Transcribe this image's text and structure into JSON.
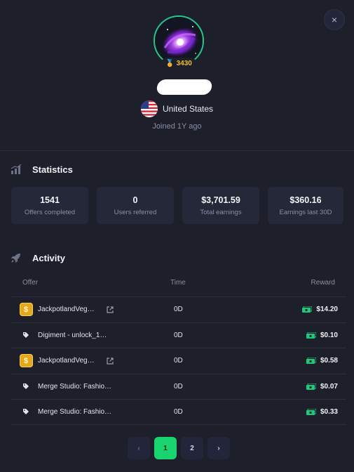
{
  "close_label": "×",
  "profile": {
    "level": "3430",
    "country": "United States",
    "joined": "Joined 1Y ago"
  },
  "statistics": {
    "title": "Statistics",
    "cards": [
      {
        "value": "1541",
        "label": "Offers completed"
      },
      {
        "value": "0",
        "label": "Users referred"
      },
      {
        "value": "$3,701.59",
        "label": "Total earnings"
      },
      {
        "value": "$360.16",
        "label": "Earnings last 30D"
      }
    ]
  },
  "activity": {
    "title": "Activity",
    "columns": {
      "offer": "Offer",
      "time": "Time",
      "reward": "Reward"
    },
    "rows": [
      {
        "offer": "JackpotlandVeg…",
        "time": "0D",
        "reward": "$14.20",
        "icon": "coin-icon",
        "external": true
      },
      {
        "offer": "Digiment - unlock_1…",
        "time": "0D",
        "reward": "$0.10",
        "icon": "tag-icon",
        "external": false
      },
      {
        "offer": "JackpotlandVeg…",
        "time": "0D",
        "reward": "$0.58",
        "icon": "coin-icon",
        "external": true
      },
      {
        "offer": "Merge Studio: Fashio…",
        "time": "0D",
        "reward": "$0.07",
        "icon": "tag-icon",
        "external": false
      },
      {
        "offer": "Merge Studio: Fashio…",
        "time": "0D",
        "reward": "$0.33",
        "icon": "tag-icon",
        "external": false
      }
    ]
  },
  "pagination": {
    "prev": "‹",
    "pages": [
      "1",
      "2"
    ],
    "current": "1",
    "next": "›"
  },
  "colors": {
    "accent": "#19d46e",
    "level": "#f0c030",
    "background": "#1d1f2b",
    "card": "#252839"
  }
}
